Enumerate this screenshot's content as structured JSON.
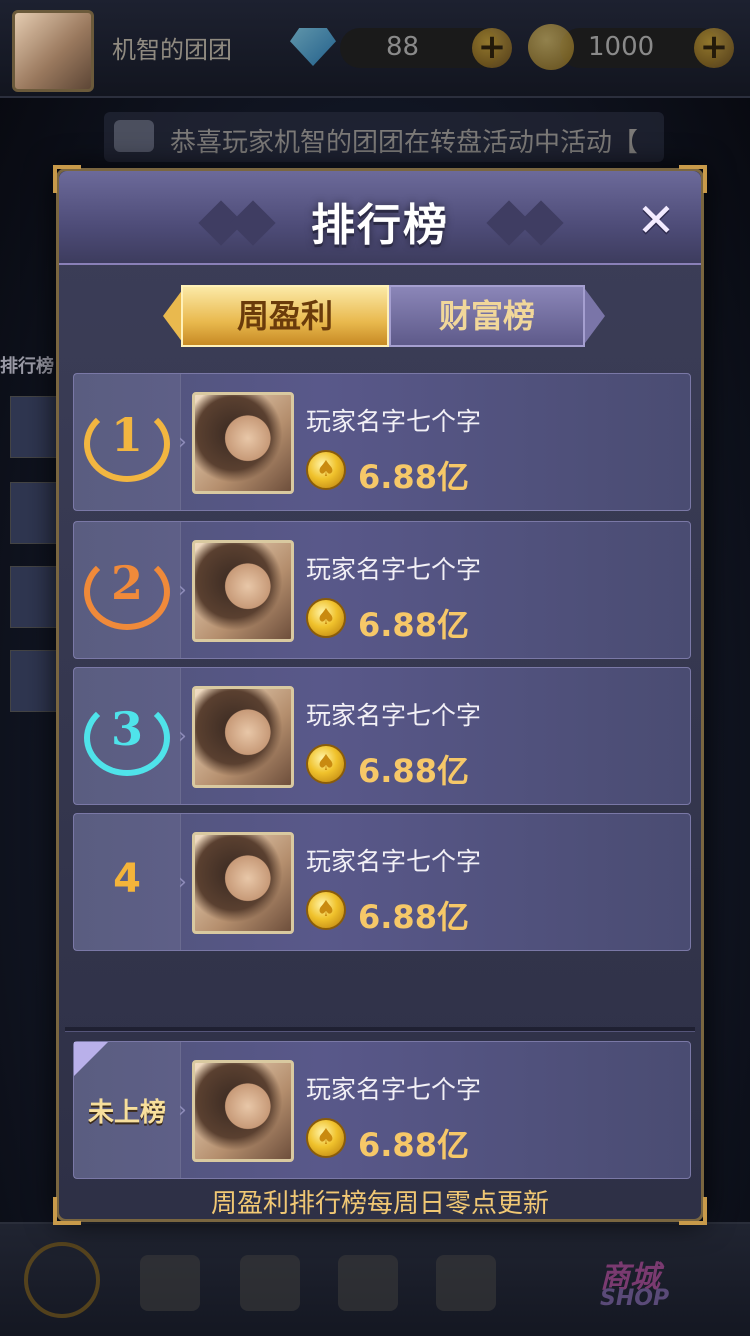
{
  "player": {
    "name": "机智的团团",
    "diamonds": "88",
    "coins": "1000",
    "plus": "+"
  },
  "marquee": {
    "text": "恭喜玩家机智的团团在转盘活动中活动【"
  },
  "side": {
    "label": "排行榜"
  },
  "modal": {
    "title": "排行榜",
    "close_icon": "✕",
    "tabs": [
      {
        "label": "周盈利",
        "active": true
      },
      {
        "label": "财富榜",
        "active": false
      }
    ],
    "rows": [
      {
        "rank": "1",
        "name": "玩家名字七个字",
        "amount": "6.88亿",
        "medal": "gold"
      },
      {
        "rank": "2",
        "name": "玩家名字七个字",
        "amount": "6.88亿",
        "medal": "bronze"
      },
      {
        "rank": "3",
        "name": "玩家名字七个字",
        "amount": "6.88亿",
        "medal": "cyan"
      },
      {
        "rank": "4",
        "name": "玩家名字七个字",
        "amount": "6.88亿",
        "medal": "none"
      }
    ],
    "self_row": {
      "status": "未上榜",
      "name": "玩家名字七个字",
      "amount": "6.88亿"
    },
    "footer": "周盈利排行榜每周日零点更新"
  },
  "shop": {
    "label": "商城",
    "sub": "SHOP"
  },
  "colors": {
    "gold_medal": "#f2b640",
    "bronze_medal": "#f08a3a",
    "cyan_medal": "#4fe3ea",
    "amount": "#f6c868"
  }
}
